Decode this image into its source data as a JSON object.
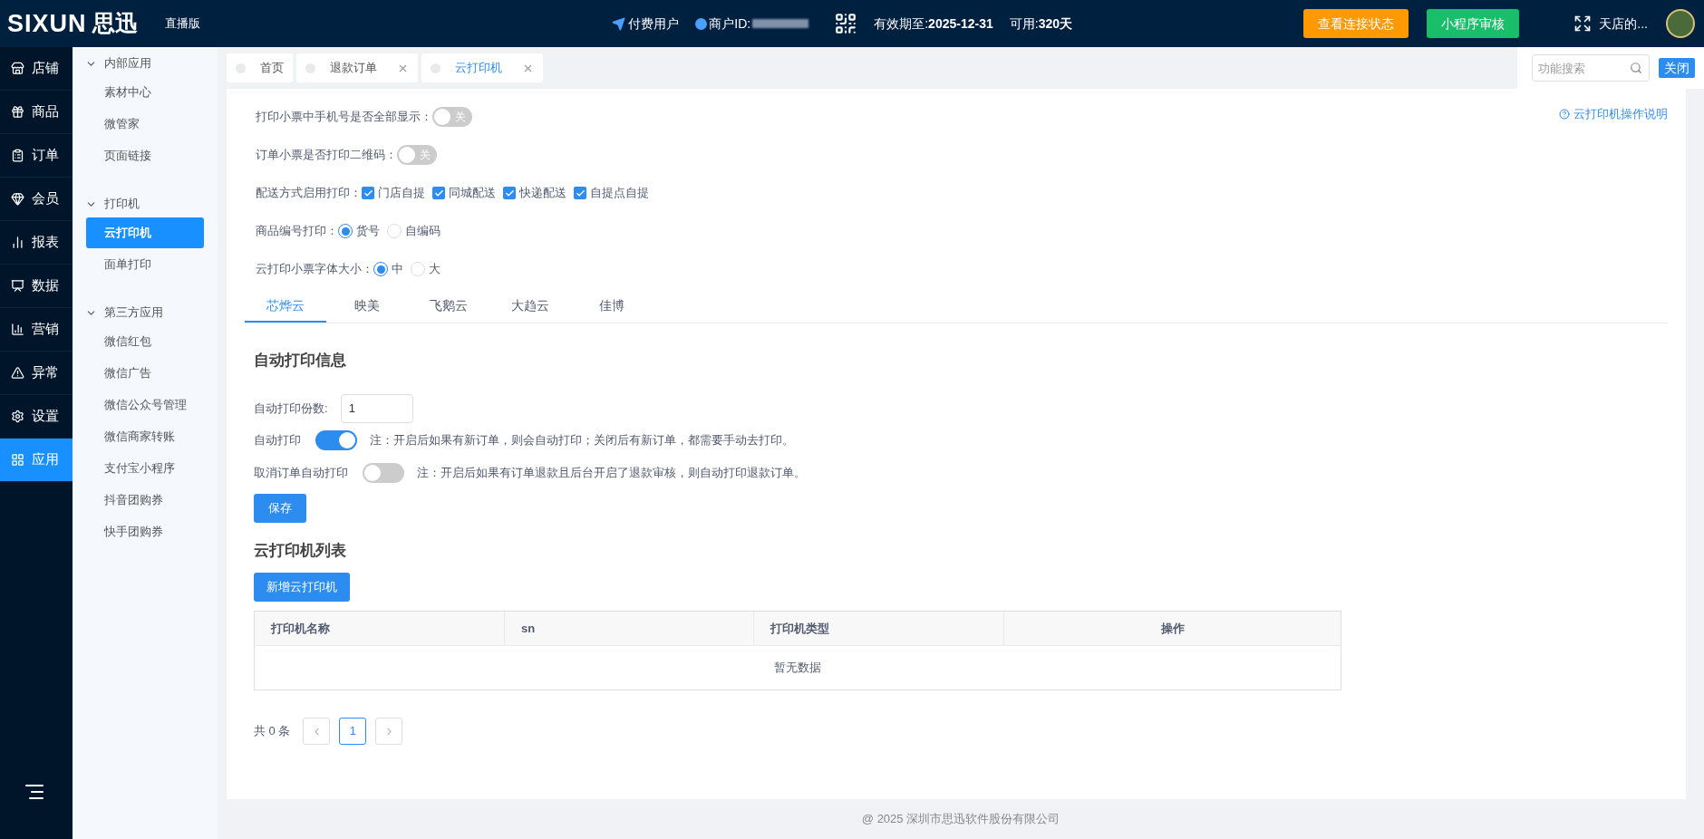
{
  "header": {
    "logo": "SIXUN",
    "logo_cn": "思迅",
    "edition": "直播版",
    "user_type": "付费用户",
    "merchant_label": "商户ID:",
    "expiry_label": "有效期至:",
    "expiry": "2025-12-31",
    "avail_label": "可用:",
    "avail": "320天",
    "buttons": [
      {
        "label": "查看连接状态",
        "kind": "warning"
      },
      {
        "label": "小程序审核",
        "kind": "success"
      }
    ],
    "shop": "天店的..."
  },
  "nav": [
    {
      "label": "店铺",
      "selected": false
    },
    {
      "label": "商品",
      "selected": false
    },
    {
      "label": "订单",
      "selected": false
    },
    {
      "label": "会员",
      "selected": false
    },
    {
      "label": "报表",
      "selected": false
    },
    {
      "label": "数据",
      "selected": false
    },
    {
      "label": "营销",
      "selected": false
    },
    {
      "label": "异常",
      "selected": false
    },
    {
      "label": "设置",
      "selected": false
    },
    {
      "label": "应用",
      "selected": true
    }
  ],
  "subnav": [
    {
      "title": "内部应用",
      "expanded": true,
      "items": [
        {
          "label": "素材中心",
          "selected": false
        },
        {
          "label": "微管家",
          "selected": false
        },
        {
          "label": "页面链接",
          "selected": false
        }
      ]
    },
    {
      "title": "打印机",
      "expanded": true,
      "items": [
        {
          "label": "云打印机",
          "selected": true
        },
        {
          "label": "面单打印",
          "selected": false
        }
      ]
    },
    {
      "title": "第三方应用",
      "expanded": true,
      "items": [
        {
          "label": "微信红包",
          "selected": false
        },
        {
          "label": "微信广告",
          "selected": false
        },
        {
          "label": "微信公众号管理",
          "selected": false
        },
        {
          "label": "微信商家转账",
          "selected": false
        },
        {
          "label": "支付宝小程序",
          "selected": false
        },
        {
          "label": "抖音团购券",
          "selected": false
        },
        {
          "label": "快手团购券",
          "selected": false
        }
      ]
    }
  ],
  "page_tabs": [
    {
      "label": "首页",
      "selected": false,
      "closable": false
    },
    {
      "label": "退款订单",
      "selected": false,
      "closable": true
    },
    {
      "label": "云打印机",
      "selected": true,
      "closable": true
    }
  ],
  "search": {
    "placeholder": "功能搜索"
  },
  "close_button": "关闭",
  "help_link": "云打印机操作说明",
  "settings": [
    {
      "kind": "switch",
      "label": "打印小票中手机号是否全部显示：",
      "on": false,
      "text": "关"
    },
    {
      "kind": "switch",
      "label": "订单小票是否打印二维码：",
      "on": false,
      "text": "关"
    },
    {
      "kind": "checkboxes",
      "label": "配送方式启用打印：",
      "options": [
        {
          "label": "门店自提",
          "checked": true
        },
        {
          "label": "同城配送",
          "checked": true
        },
        {
          "label": "快递配送",
          "checked": true
        },
        {
          "label": "自提点自提",
          "checked": true
        }
      ]
    },
    {
      "kind": "radios",
      "label": "商品编号打印：",
      "options": [
        {
          "label": "货号",
          "selected": true
        },
        {
          "label": "自编码",
          "selected": false
        }
      ]
    },
    {
      "kind": "radios",
      "label": "云打印小票字体大小：",
      "options": [
        {
          "label": "中",
          "selected": true
        },
        {
          "label": "大",
          "selected": false
        }
      ]
    }
  ],
  "provider_tabs": [
    {
      "label": "芯烨云",
      "selected": true
    },
    {
      "label": "映美",
      "selected": false
    },
    {
      "label": "飞鹅云",
      "selected": false
    },
    {
      "label": "大趋云",
      "selected": false
    },
    {
      "label": "佳博",
      "selected": false
    }
  ],
  "auto_print": {
    "title": "自动打印信息",
    "copies_label": "自动打印份数:",
    "copies": "1",
    "toggles": [
      {
        "label": "自动打印",
        "on": true,
        "note": "注：开启后如果有新订单，则会自动打印；关闭后有新订单，都需要手动去打印。"
      },
      {
        "label": "取消订单自动打印",
        "on": false,
        "note": "注：开启后如果有订单退款且后台开启了退款审核，则自动打印退款订单。"
      }
    ],
    "save": "保存"
  },
  "printer_list": {
    "title": "云打印机列表",
    "add_button": "新增云打印机",
    "columns": [
      "打印机名称",
      "sn",
      "打印机类型",
      "操作"
    ],
    "empty": "暂无数据"
  },
  "pagination": {
    "total": "共 0 条",
    "pages": [
      {
        "label": "1",
        "selected": true
      }
    ]
  },
  "footer": "@ 2025 深圳市思迅软件股份有限公司"
}
